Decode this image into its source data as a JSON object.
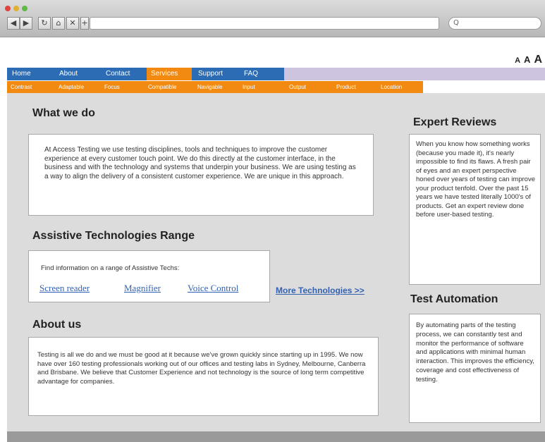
{
  "browser": {
    "nav_buttons": [
      "◀",
      "▶",
      "↻",
      "⌂",
      "✕",
      "+"
    ],
    "search_placeholder": "Q",
    "traffic_lights": [
      "close",
      "minimize",
      "maximize"
    ]
  },
  "text_size": [
    "A",
    "A",
    "A"
  ],
  "primary_nav": [
    "Home",
    "About",
    "Contact",
    "Services",
    "Support",
    "FAQ"
  ],
  "primary_nav_active": "Services",
  "secondary_nav": [
    "Contrast",
    "Adaptable",
    "Focus",
    "Compatible",
    "Navigable",
    "Input",
    "Output",
    "Product",
    "Location"
  ],
  "what_we_do": {
    "title": "What we do",
    "body": "At Access Testing we use testing disciplines, tools and techniques to improve the customer experience at every customer touch point. We do this directly at the customer interface, in the business and with the technology and systems that underpin your business. We are using testing as a way to align the delivery of a consistent customer experience. We are unique in this approach."
  },
  "assistive": {
    "title": "Assistive Technologies Range",
    "intro": "Find information on a range of Assistive Techs:",
    "links": [
      "Screen reader",
      "Magnifier",
      "Voice Control"
    ],
    "more": "More Technologies >>"
  },
  "about": {
    "title": "About us",
    "body": "Testing is all we do and we must be good at it because we've grown quickly since starting up in 1995. We now have over 160 testing professionals working out of our offices and testing labs in Sydney, Melbourne, Canberra and Brisbane. We believe that Customer Experience and not technology is the source of long term competitive advantage for companies."
  },
  "expert_reviews": {
    "title": "Expert Reviews",
    "body": "When you know how something works (because you made it), it's nearly impossible to find its flaws. A fresh pair of eyes and an expert perspective honed over years of testing can improve your product tenfold. Over the past 15 years we have tested literally 1000's of products. Get an expert review done before user-based testing."
  },
  "test_automation": {
    "title": "Test Automation",
    "body": "By automating parts of the testing process, we can constantly test and monitor the performance of software and applications with minimal human interaction. This improves the efficiency, coverage and cost effectiveness of testing."
  },
  "colors": {
    "nav_blue": "#2b6cb5",
    "nav_orange": "#f28a12",
    "nav_lavender": "#cdc5e0",
    "content_bg": "#dcdcdc",
    "link_blue": "#3361b4"
  }
}
